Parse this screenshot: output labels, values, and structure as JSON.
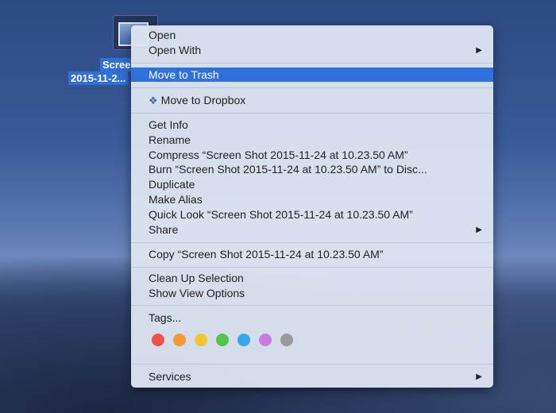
{
  "desktop": {
    "file_label_line1": "Scree",
    "file_label_line2": "2015-11-2..."
  },
  "menu": {
    "open": "Open",
    "open_with": "Open With",
    "move_to_trash": "Move to Trash",
    "move_to_dropbox": "Move to Dropbox",
    "get_info": "Get Info",
    "rename": "Rename",
    "compress": "Compress “Screen Shot 2015-11-24 at 10.23.50 AM”",
    "burn": "Burn “Screen Shot 2015-11-24 at 10.23.50 AM” to Disc...",
    "duplicate": "Duplicate",
    "make_alias": "Make Alias",
    "quick_look": "Quick Look “Screen Shot 2015-11-24 at 10.23.50 AM”",
    "share": "Share",
    "copy": "Copy “Screen Shot 2015-11-24 at 10.23.50 AM”",
    "clean_up": "Clean Up Selection",
    "show_view_options": "Show View Options",
    "tags": "Tags...",
    "services": "Services",
    "submenu_arrow": "▶"
  },
  "tag_colors": [
    "#f0504a",
    "#f59a30",
    "#f2c630",
    "#52c44a",
    "#35a8ec",
    "#c77ee0",
    "#9a9a9e"
  ],
  "highlight_color": "#2f70dc"
}
